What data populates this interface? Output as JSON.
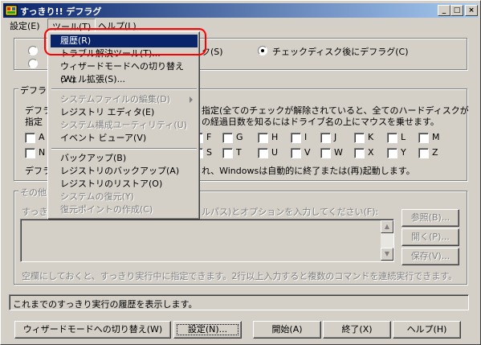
{
  "window": {
    "title": "すっきり!! デフラグ",
    "minimize": "_",
    "maximize": "□",
    "close": "×"
  },
  "menubar": {
    "items": [
      {
        "label": "設定(E)"
      },
      {
        "label": "ツール(T)"
      },
      {
        "label": "ヘルプ(L)"
      }
    ]
  },
  "top": {
    "radio_left_text": "ク(S)",
    "radio_right_text": "チェックディスク後にデフラグ(C)"
  },
  "defrag_group": {
    "label": "デフラ",
    "desc_left_1": "デフラ",
    "desc_left_2": "指定",
    "desc_right_1": "指定(全てのチェックが解除されていると、全てのハードディスクが",
    "desc_right_2": "の経過日数を知るにはドライブ名の上にマウスを乗せます。",
    "row1": [
      "A",
      "F",
      "G",
      "H",
      "I",
      "J",
      "K",
      "L",
      "M"
    ],
    "row2": [
      "N",
      "S",
      "T",
      "U",
      "V",
      "W",
      "X",
      "Y",
      "Z"
    ],
    "footer_left": "デフラ",
    "footer_right": "れ、Windowsは自動的に終了または(再)起動します。"
  },
  "other_group": {
    "label": "その他",
    "prompt_left": "すっき",
    "prompt_right": "ルパス)とオプションを入力してください(F):",
    "browse": "参照(B)...",
    "open": "開く(P)...",
    "save": "保存(V)...",
    "note": "空欄にしておくと、すっきり実行中に指定できます。2行以上入力すると複数のコマンドを連続実行できます。"
  },
  "status": {
    "text": "これまでのすっきり実行の履歴を表示します。"
  },
  "buttons": {
    "wizard": "ウィザードモードへの切り替え(W)",
    "settings": "設定(N)...",
    "start": "開始(A)",
    "exit": "終了(X)",
    "help": "ヘルプ(H)"
  },
  "tools_menu": {
    "items": [
      {
        "label": "履歴(R)",
        "state": "selected"
      },
      {
        "label": "トラブル解決ツール(T)...",
        "state": "normal"
      },
      {
        "label": "ウィザードモードへの切り替え(W)",
        "state": "normal"
      },
      {
        "label": "シェル拡張(S)...",
        "state": "normal"
      },
      {
        "label": "システムファイルの編集(D)",
        "state": "disabled",
        "submenu": true
      },
      {
        "label": "レジストリ エディタ(E)",
        "state": "normal"
      },
      {
        "label": "システム構成ユーティリティ(U)",
        "state": "disabled"
      },
      {
        "label": "イベント ビューア(V)",
        "state": "normal"
      },
      {
        "label": "バックアップ(B)",
        "state": "normal"
      },
      {
        "label": "レジストリのバックアップ(A)",
        "state": "normal"
      },
      {
        "label": "レジストリのリストア(O)",
        "state": "normal"
      },
      {
        "label": "システムの復元(Y)",
        "state": "disabled"
      },
      {
        "label": "復元ポイントの作成(C)",
        "state": "disabled"
      }
    ]
  },
  "colors": {
    "titlebar_start": "#0a246a",
    "titlebar_end": "#a6caf0",
    "selection": "#0a246a",
    "highlight_annotation": "#ff0000",
    "face": "#d4d0c8"
  },
  "icons": {
    "app": "app-icon",
    "scroll_up": "scroll-up-icon",
    "scroll_down": "scroll-down-icon",
    "submenu": "submenu-arrow-icon"
  }
}
